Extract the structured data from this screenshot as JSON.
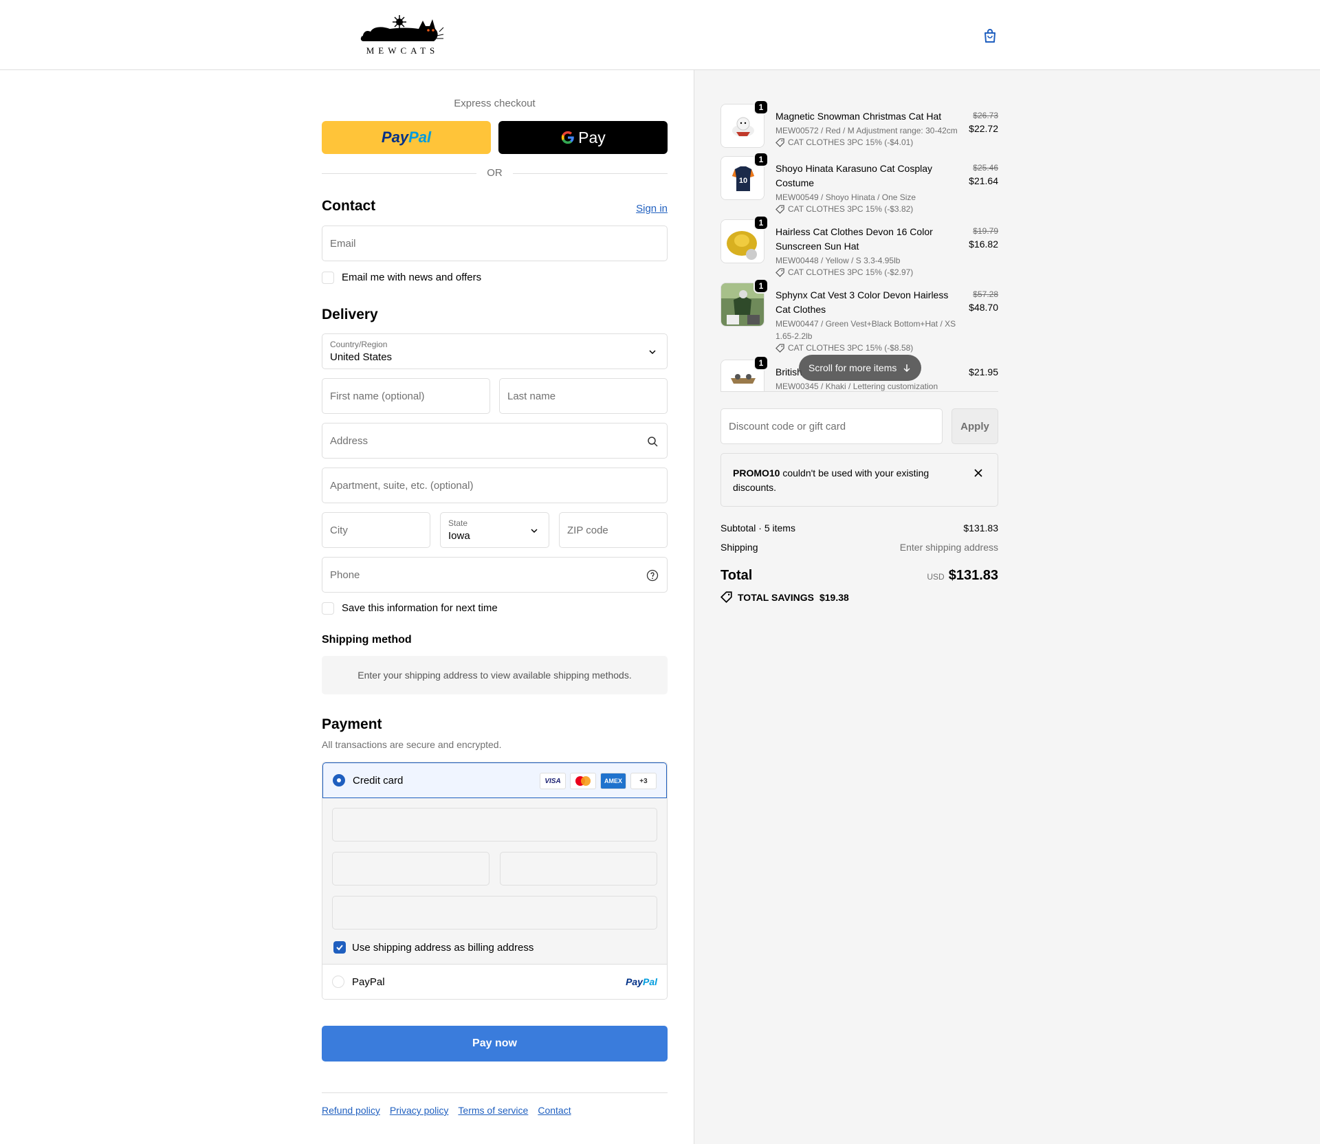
{
  "header": {
    "brand": "MEWCATS",
    "cart_icon": "shopping-bag-icon"
  },
  "express": {
    "title": "Express checkout",
    "paypal_a": "Pay",
    "paypal_b": "Pal",
    "gpay_label": "Pay",
    "or": "OR"
  },
  "contact": {
    "title": "Contact",
    "sign_in": "Sign in",
    "email_placeholder": "Email",
    "news_label": "Email me with news and offers"
  },
  "delivery": {
    "title": "Delivery",
    "country_label": "Country/Region",
    "country_value": "United States",
    "first_name": "First name (optional)",
    "last_name": "Last name",
    "address": "Address",
    "apartment": "Apartment, suite, etc. (optional)",
    "city": "City",
    "state_label": "State",
    "state_value": "Iowa",
    "zip": "ZIP code",
    "phone": "Phone",
    "save_label": "Save this information for next time"
  },
  "shipping": {
    "title": "Shipping method",
    "info": "Enter your shipping address to view available shipping methods."
  },
  "payment": {
    "title": "Payment",
    "subtitle": "All transactions are secure and encrypted.",
    "credit_card": "Credit card",
    "cards": [
      "VISA",
      "MC",
      "AMEX",
      "+3"
    ],
    "billing_label": "Use shipping address as billing address",
    "paypal": "PayPal",
    "paypal_logo_a": "Pay",
    "paypal_logo_b": "Pal",
    "pay_now": "Pay now"
  },
  "footer": {
    "links": [
      "Refund policy",
      "Privacy policy",
      "Terms of service",
      "Contact"
    ]
  },
  "items": [
    {
      "qty": "1",
      "name": "Magnetic Snowman Christmas Cat Hat",
      "variant": "MEW00572 / Red / M Adjustment range: 30-42cm",
      "discount": "CAT CLOTHES 3PC 15% (-$4.01)",
      "old_price": "$26.73",
      "price": "$22.72"
    },
    {
      "qty": "1",
      "name": "Shoyo Hinata Karasuno Cat Cosplay Costume",
      "variant": "MEW00549 / Shoyo Hinata / One Size",
      "discount": "CAT CLOTHES 3PC 15% (-$3.82)",
      "old_price": "$25.46",
      "price": "$21.64"
    },
    {
      "qty": "1",
      "name": "Hairless Cat Clothes Devon 16 Color Sunscreen Sun Hat",
      "variant": "MEW00448 / Yellow / S 3.3-4.95lb",
      "discount": "CAT CLOTHES 3PC 15% (-$2.97)",
      "old_price": "$19.79",
      "price": "$16.82"
    },
    {
      "qty": "1",
      "name": "Sphynx Cat Vest 3 Color Devon Hairless Cat Clothes",
      "variant": "MEW00447 / Green Vest+Black Bottom+Hat / XS 1.65-2.2lb",
      "discount": "CAT CLOTHES 3PC 15% (-$8.58)",
      "old_price": "$57.28",
      "price": "$48.70"
    },
    {
      "qty": "1",
      "name": "British",
      "variant": "MEW00345 / Khaki / Lettering customization",
      "price": "$21.95"
    }
  ],
  "scroll_hint": "Scroll for more items",
  "discount": {
    "placeholder": "Discount code or gift card",
    "apply": "Apply"
  },
  "promo": {
    "code": "PROMO10",
    "message": " couldn't be used with your existing discounts."
  },
  "summary": {
    "subtotal_label": "Subtotal · 5 items",
    "subtotal_value": "$131.83",
    "shipping_label": "Shipping",
    "shipping_value": "Enter shipping address",
    "total_label": "Total",
    "currency": "USD",
    "total_value": "$131.83",
    "savings_label": "TOTAL SAVINGS",
    "savings_value": "$19.38"
  },
  "colors": {
    "accent": "#1f5fbf",
    "pay_button": "#3a7cdc",
    "paypal_yellow": "#ffc439"
  }
}
